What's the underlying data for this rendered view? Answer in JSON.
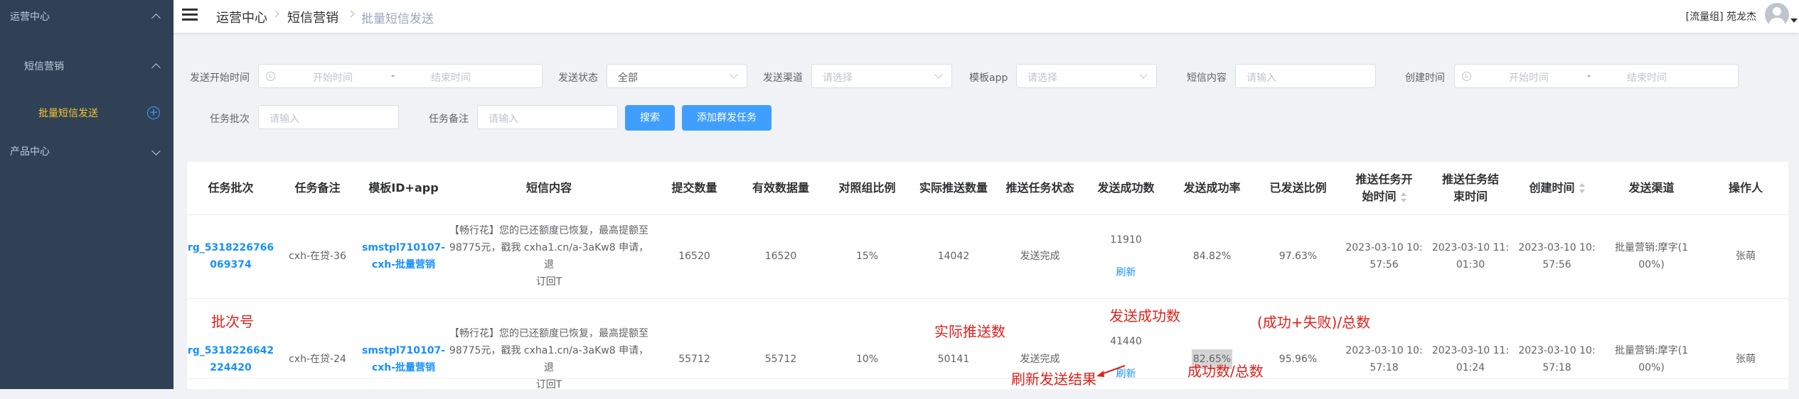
{
  "sidebar": {
    "items": [
      {
        "label": "运营中心"
      },
      {
        "label": "短信营销"
      },
      {
        "label": "批量短信发送"
      },
      {
        "label": "产品中心"
      }
    ]
  },
  "header": {
    "breadcrumb": [
      "运营中心",
      "短信营销",
      "批量短信发送"
    ],
    "user": "[流量组] 苑龙杰"
  },
  "filters": {
    "send_start_time": {
      "label": "发送开始时间",
      "start_placeholder": "开始时间",
      "sep": "-",
      "end_placeholder": "结束时间"
    },
    "send_status": {
      "label": "发送状态",
      "value": "全部"
    },
    "send_channel": {
      "label": "发送渠道",
      "placeholder": "请选择"
    },
    "template_app": {
      "label": "模板app",
      "placeholder": "请选择"
    },
    "sms_content": {
      "label": "短信内容",
      "placeholder": "请输入"
    },
    "create_time": {
      "label": "创建时间",
      "start_placeholder": "开始时间",
      "sep": "-",
      "end_placeholder": "结束时间"
    },
    "task_batch": {
      "label": "任务批次",
      "placeholder": "请输入"
    },
    "task_note": {
      "label": "任务备注",
      "placeholder": "请输入"
    },
    "search_button": "搜索",
    "add_button": "添加群发任务"
  },
  "table": {
    "headers": [
      "任务批次",
      "任务备注",
      "模板ID+app",
      "短信内容",
      "提交数量",
      "有效数据量",
      "对照组比例",
      "实际推送数量",
      "推送任务状态",
      "发送成功数",
      "发送成功率",
      "已发送比例",
      "推送任务开始时间",
      "推送任务结束时间",
      "创建时间",
      "发送渠道",
      "操作人"
    ],
    "rows": [
      {
        "batch_a": "rg_5318226766",
        "batch_b": "069374",
        "note": "cxh-在贷-36",
        "tpl_a": "smstpl710107-",
        "tpl_b": "cxh-批量营销",
        "content_a": "【畅行花】您的已还额度已恢复，最高提额至",
        "content_b": "98775元，戳我 cxha1.cn/a-3aKw8 申请，退",
        "content_c": "订回T",
        "submit": "16520",
        "valid": "16520",
        "control": "15%",
        "pushed": "14042",
        "status": "发送完成",
        "success": "11910",
        "refresh": "刷新",
        "rate": "84.82%",
        "sent_ratio": "97.63%",
        "start_a": "2023-03-10 10:",
        "start_b": "57:56",
        "end_a": "2023-03-10 11:",
        "end_b": "01:30",
        "create_a": "2023-03-10 10:",
        "create_b": "57:56",
        "channel_a": "批量营销:摩字(1",
        "channel_b": "00%)",
        "operator": "张萌"
      },
      {
        "batch_a": "rg_5318226642",
        "batch_b": "224420",
        "note": "cxh-在贷-24",
        "tpl_a": "smstpl710107-",
        "tpl_b": "cxh-批量营销",
        "content_a": "【畅行花】您的已还额度已恢复，最高提额至",
        "content_b": "98775元，戳我 cxha1.cn/a-3aKw8 申请，退",
        "content_c": "订回T",
        "submit": "55712",
        "valid": "55712",
        "control": "10%",
        "pushed": "50141",
        "status": "发送完成",
        "success": "41440",
        "refresh": "刷新",
        "rate": "82.65%",
        "sent_ratio": "95.96%",
        "start_a": "2023-03-10 10:",
        "start_b": "57:18",
        "end_a": "2023-03-10 11:",
        "end_b": "01:24",
        "create_a": "2023-03-10 10:",
        "create_b": "57:18",
        "channel_a": "批量营销:摩字(1",
        "channel_b": "00%)",
        "operator": "张萌"
      }
    ]
  },
  "annotations": {
    "batch_no": "批次号",
    "actual_pushed": "实际推送数",
    "success_count": "发送成功数",
    "success_fail_total": "(成功+失败)/总数",
    "refresh_result": "刷新发送结果",
    "success_over_total": "成功数/总数"
  },
  "colors": {
    "sidebar": "#304156",
    "primary": "#409eff",
    "link": "#1890ff",
    "annotation": "#e0201c",
    "active_menu": "#f4c430"
  }
}
